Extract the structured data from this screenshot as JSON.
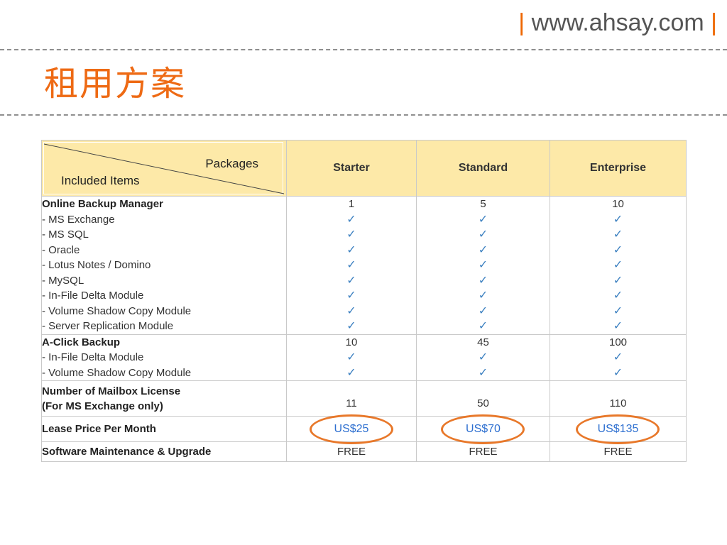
{
  "header": {
    "pipe_left": "|",
    "url": "www.ahsay.com",
    "pipe_right": "|"
  },
  "slide": {
    "title": "租用方案"
  },
  "table": {
    "corner_top": "Packages",
    "corner_bottom": "Included Items",
    "packages": [
      "Starter",
      "Standard",
      "Enterprise"
    ],
    "obm": {
      "title": "Online Backup Manager",
      "items": [
        "- MS Exchange",
        "- MS SQL",
        "- Oracle",
        "- Lotus Notes / Domino",
        "- MySQL",
        "- In-File Delta Module",
        "- Volume Shadow Copy Module",
        "- Server Replication Module"
      ],
      "counts": [
        "1",
        "5",
        "10"
      ]
    },
    "acb": {
      "title": "A-Click Backup",
      "items": [
        "- In-File Delta Module",
        "- Volume Shadow Copy Module"
      ],
      "counts": [
        "10",
        "45",
        "100"
      ]
    },
    "mailbox": {
      "label_line1": "Number of Mailbox License",
      "label_line2": "(For MS Exchange only)",
      "values": [
        "11",
        "50",
        "110"
      ]
    },
    "lease": {
      "label": "Lease Price Per Month",
      "values": [
        "US$25",
        "US$70",
        "US$135"
      ]
    },
    "maintenance": {
      "label": "Software Maintenance & Upgrade",
      "values": [
        "FREE",
        "FREE",
        "FREE"
      ]
    },
    "check_symbol": "✓"
  },
  "colors": {
    "accent": "#ee6a14",
    "header_bg": "#fde9a8",
    "check": "#3a7fc0",
    "price": "#2d6fd0",
    "ring": "#e8782a"
  }
}
